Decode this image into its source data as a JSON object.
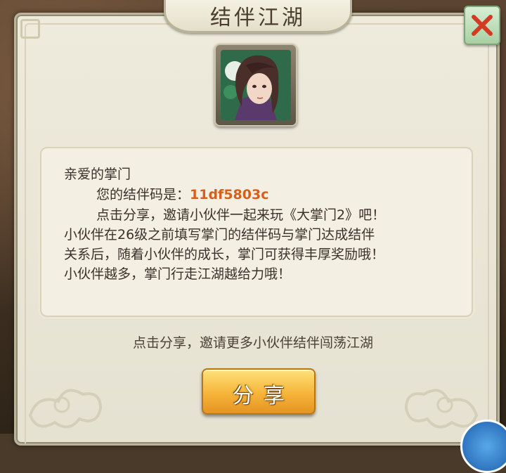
{
  "dialog": {
    "title": "结伴江湖",
    "close_icon": "close-x-icon"
  },
  "message": {
    "greeting": "亲爱的掌门",
    "code_prefix": "您的结伴码是：",
    "code_value": "11df5803c",
    "line2": "点击分享，邀请小伙伴一起来玩《大掌门2》吧！",
    "line3": "小伙伴在26级之前填写掌门的结伴码与掌门达成结伴",
    "line4": "关系后，随着小伙伴的成长，掌门可获得丰厚奖励哦！",
    "line5": "小伙伴越多，掌门行走江湖越给力哦！"
  },
  "hint": "点击分享，邀请更多小伙伴结伴闯荡江湖",
  "share_button": {
    "label": "分享"
  },
  "colors": {
    "code": "#d65f1c",
    "button": "#f6b43a",
    "close": "#d23a24"
  }
}
